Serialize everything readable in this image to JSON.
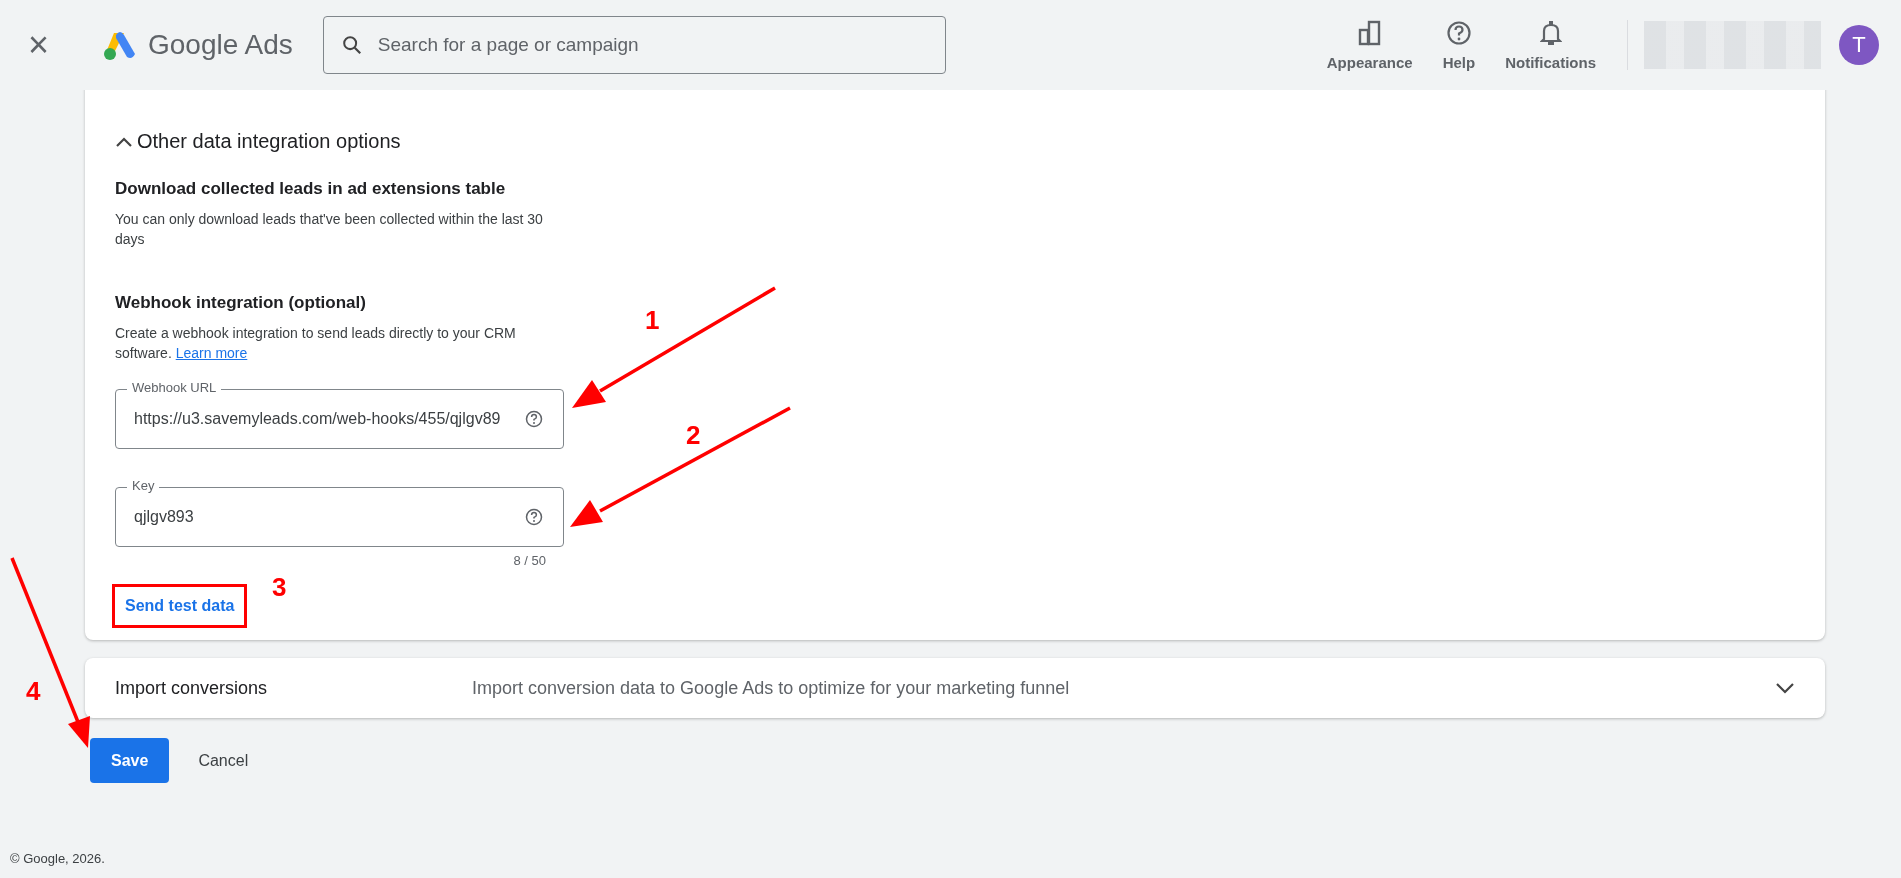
{
  "header": {
    "close": "×",
    "logo_text": "Google Ads",
    "search": {
      "placeholder": "Search for a page or campaign"
    },
    "actions": [
      {
        "kind": "appearance",
        "label": "Appearance"
      },
      {
        "kind": "help",
        "label": "Help"
      },
      {
        "kind": "notifications",
        "label": "Notifications"
      }
    ],
    "avatar": "T"
  },
  "card": {
    "section_toggle": {
      "label": "Other data integration options",
      "expanded": true
    },
    "download": {
      "heading": "Download collected leads in ad extensions table",
      "text": "You can only download leads that've been collected within the last 30 days"
    },
    "webhook": {
      "heading": "Webhook integration (optional)",
      "text": "Create a webhook integration to send leads directly to your CRM software.",
      "link": "Learn more",
      "fields": [
        {
          "label": "Webhook URL",
          "value": "https://u3.savemyleads.com/web-hooks/455/qjlgv89"
        },
        {
          "label": "Key",
          "value": "qjlgv893",
          "counter": "8 / 50"
        }
      ],
      "test_link": "Send test data"
    }
  },
  "import_panel": {
    "title": "Import conversions",
    "description": "Import conversion data to Google Ads to optimize for your marketing funnel",
    "expanded": false
  },
  "buttons": [
    {
      "kind": "primary",
      "label": "Save"
    },
    {
      "kind": "text",
      "label": "Cancel"
    }
  ],
  "footer": "© Google, 2026.",
  "annotations": [
    "1",
    "2",
    "3",
    "4"
  ]
}
